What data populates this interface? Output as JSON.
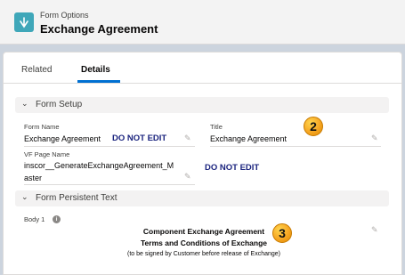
{
  "header": {
    "object_type": "Form Options",
    "record_title": "Exchange Agreement"
  },
  "tabs": [
    {
      "label": "Related"
    },
    {
      "label": "Details"
    }
  ],
  "sections": {
    "form_setup": {
      "title": "Form Setup",
      "fields": {
        "form_name": {
          "label": "Form Name",
          "value": "Exchange Agreement"
        },
        "title": {
          "label": "Title",
          "value": "Exchange Agreement"
        },
        "vf_page_name": {
          "label": "VF Page Name",
          "value_line1": "inscor__GenerateExchangeAgreement_M",
          "value_line2": "aster"
        }
      }
    },
    "persistent_text": {
      "title": "Form Persistent Text",
      "body1": {
        "label": "Body 1",
        "line1": "Component Exchange Agreement",
        "line2": "Terms and Conditions of Exchange",
        "line3": "(to be signed by Customer before release of Exchange)"
      }
    }
  },
  "annotations": {
    "do_not_edit_1": "DO NOT EDIT",
    "do_not_edit_2": "DO NOT EDIT",
    "badge_2": "2",
    "badge_3": "3"
  },
  "icons": {
    "object_icon": "form-options-icon",
    "chevron": "chevron-down-icon",
    "edit": "pencil-icon",
    "info": "info-icon"
  },
  "colors": {
    "tab_active_underline": "#0070d2",
    "badge": "#f6a623",
    "annotation_text": "#1a237e"
  }
}
